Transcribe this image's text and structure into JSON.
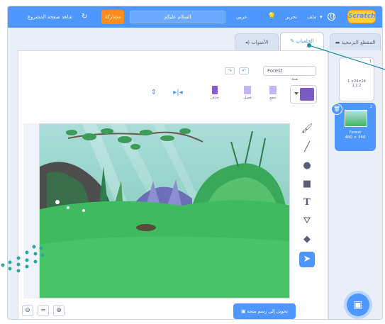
{
  "menubar": {
    "logo": "Scratch",
    "file_menu": "ملف",
    "edit_menu": "تحرير",
    "tutorials": "دروس",
    "language": "عربي",
    "project_title": "السلام عليكم",
    "share_button": "مشاركة",
    "see_project_page": "شاهد صفحة المشروع"
  },
  "tabs": {
    "code": "المقطع البرمجية",
    "costumes": "الخلفيات",
    "sounds": "الأصوات"
  },
  "editor": {
    "costume_name": "Forest",
    "fill_label": "تعبئة",
    "fill_color": "#7a5bc6",
    "group_label": "جمع",
    "ungroup_label": "فصل",
    "delete_label": "حذف",
    "convert_button": "تحويل إلى رسم متجه"
  },
  "sprites": {
    "stage_number": "1",
    "stage_size": "1 ×24×24\n1.2.2",
    "backdrop_number": "2",
    "backdrop_name": "Forest",
    "backdrop_size": "480 × 360"
  },
  "colors": {
    "menubar": "#4d97ff",
    "share": "#ff8c1a",
    "accent": "#4d97ff",
    "fill_purple": "#7a5bc6"
  }
}
